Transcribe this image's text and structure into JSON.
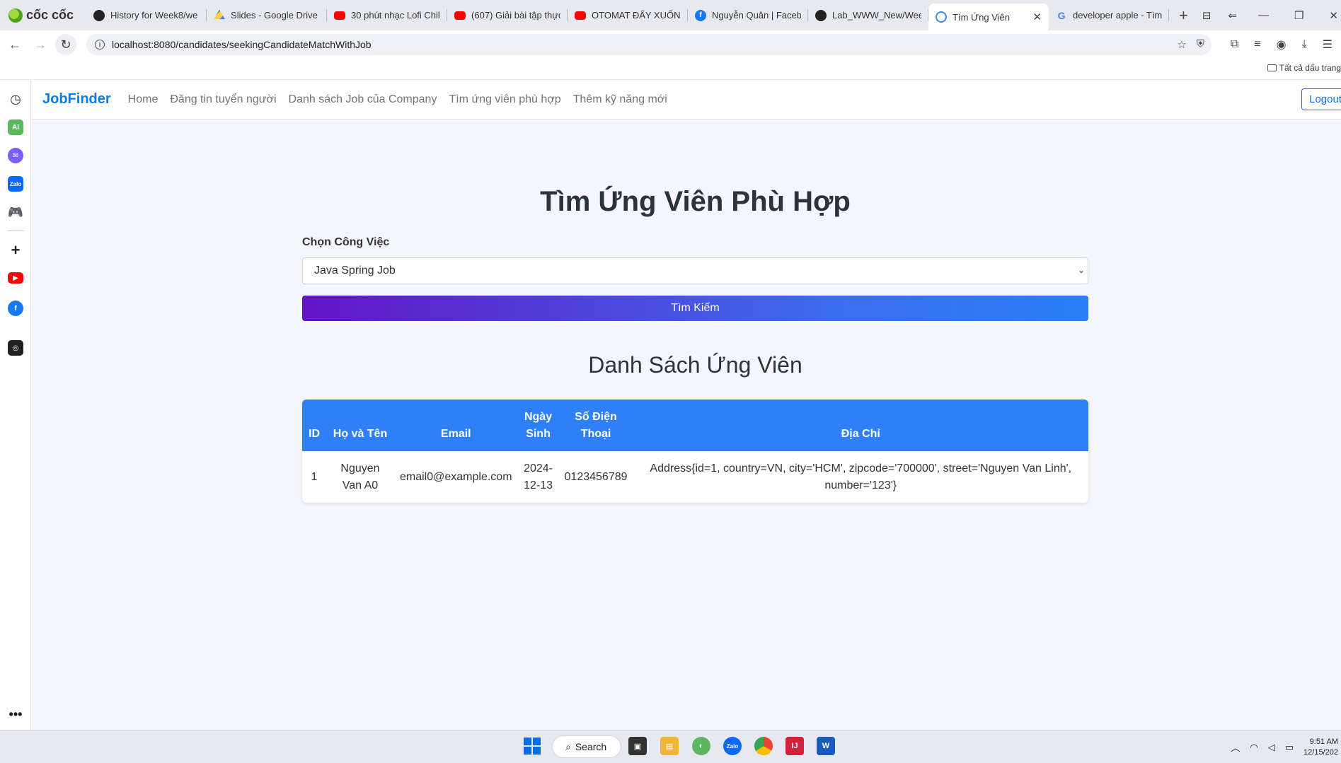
{
  "browser": {
    "brand": "cốc cốc",
    "tabs": [
      {
        "icon": "github-icon",
        "title": "History for Week8/we"
      },
      {
        "icon": "google-drive-icon",
        "title": "Slides - Google Drive"
      },
      {
        "icon": "youtube-icon",
        "title": "30 phút nhạc Lofi Chil"
      },
      {
        "icon": "youtube-icon",
        "title": "(607) Giải bài tập thực"
      },
      {
        "icon": "youtube-icon",
        "title": "OTOMAT ĐẨY XUỐNG"
      },
      {
        "icon": "facebook-icon",
        "title": "Nguyễn Quân | Faceb"
      },
      {
        "icon": "github-icon",
        "title": "Lab_WWW_New/Wee"
      },
      {
        "icon": "globe-icon",
        "title": "Tìm Ứng Viên"
      },
      {
        "icon": "google-icon",
        "title": "developer apple - Tìm"
      }
    ],
    "url": "localhost:8080/candidates/seekingCandidateMatchWithJob",
    "bookmark_folder": "Tất cả dấu trang"
  },
  "navbar": {
    "brand": "JobFinder",
    "links": [
      "Home",
      "Đăng tin tuyển người",
      "Danh sách Job của Company",
      "Tìm ứng viên phù hợp",
      "Thêm kỹ năng mới"
    ],
    "logout": "Logout"
  },
  "main": {
    "title": "Tìm Ứng Viên Phù Hợp",
    "job_label": "Chọn Công Việc",
    "job_selected": "Java Spring Job",
    "search_button": "Tìm Kiếm",
    "list_title": "Danh Sách Ứng Viên"
  },
  "table": {
    "headers": [
      "ID",
      "Họ và Tên",
      "Email",
      "Ngày Sinh",
      "Số Điện Thoại",
      "Địa Chỉ"
    ],
    "rows": [
      {
        "id": "1",
        "name": "Nguyen Van A0",
        "email": "email0@example.com",
        "dob": "2024-12-13",
        "phone": "0123456789",
        "address": "Address{id=1, country=VN, city='HCM', zipcode='700000', street='Nguyen Van Linh', number='123'}"
      }
    ]
  },
  "taskbar": {
    "search_label": "Search",
    "time": "9:51 AM",
    "date": "12/15/202"
  },
  "colors": {
    "brand_blue": "#0d7ae8",
    "table_header": "#2f80f7",
    "button_gradient_start": "#6314c8",
    "button_gradient_end": "#2a7ef8"
  }
}
